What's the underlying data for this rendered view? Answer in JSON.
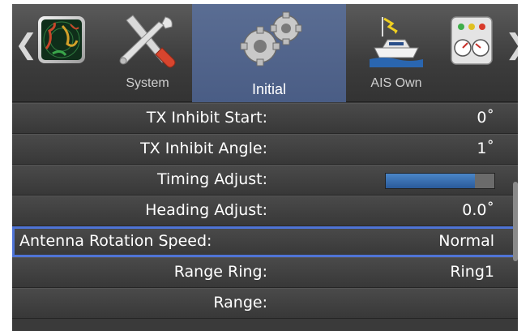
{
  "nav": {
    "prev_arrow": "❮",
    "next_arrow": "❯"
  },
  "tabs": [
    {
      "id": "radar",
      "label": "",
      "icon": "radar-icon"
    },
    {
      "id": "system",
      "label": "System",
      "icon": "tools-icon"
    },
    {
      "id": "initial",
      "label": "Initial",
      "icon": "gears-icon",
      "selected": true
    },
    {
      "id": "ais_own",
      "label": "AIS Own",
      "icon": "boat-icon"
    },
    {
      "id": "alarm",
      "label": "",
      "icon": "gauges-icon"
    }
  ],
  "settings": [
    {
      "name": "TX Inhibit Start:",
      "value": "0˚"
    },
    {
      "name": "TX Inhibit Angle:",
      "value": "1˚"
    },
    {
      "name": "Timing Adjust:",
      "value": "",
      "bar_fraction": 0.82
    },
    {
      "name": "Heading Adjust:",
      "value": "0.0˚"
    },
    {
      "name": "Antenna Rotation Speed:",
      "value": "Normal",
      "selected": true
    },
    {
      "name": "Range Ring:",
      "value": "Ring1"
    },
    {
      "name": "Range:",
      "value": ""
    }
  ],
  "colors": {
    "selection_outline": "#4f74d6",
    "active_tab": "#5168a0",
    "bar_fill": "#3a72b8"
  }
}
